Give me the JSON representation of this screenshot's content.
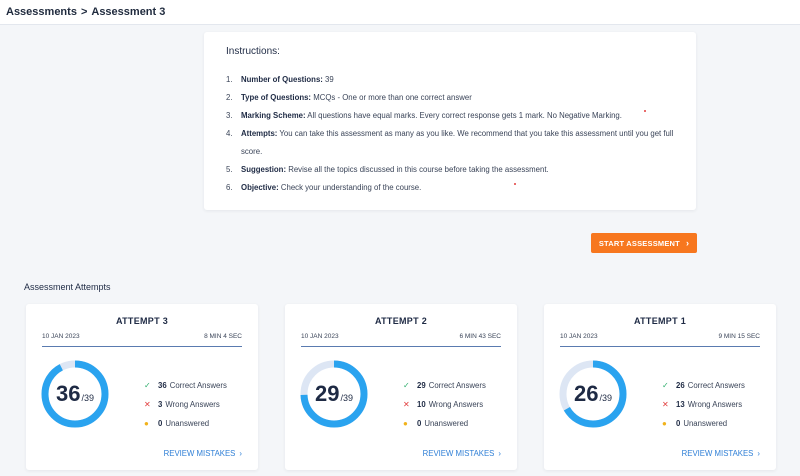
{
  "breadcrumb": {
    "root": "Assessments",
    "separator": ">",
    "current": "Assessment 3"
  },
  "instructions": {
    "title": "Instructions:",
    "items": [
      {
        "num": "1.",
        "label": "Number of Questions:",
        "text": " 39"
      },
      {
        "num": "2.",
        "label": "Type of Questions:",
        "text": " MCQs - One or more than one correct answer"
      },
      {
        "num": "3.",
        "label": "Marking Scheme:",
        "text": " All questions have equal marks. Every correct response gets 1 mark. No Negative Marking."
      },
      {
        "num": "4.",
        "label": "Attempts:",
        "text": " You can take this assessment as many as you like. We recommend that you take this assessment until you get full score."
      },
      {
        "num": "5.",
        "label": "Suggestion:",
        "text": " Revise all the topics discussed in this course before taking the assessment."
      },
      {
        "num": "6.",
        "label": "Objective:",
        "text": " Check your understanding of the course."
      }
    ]
  },
  "start_button": {
    "label": "START ASSESSMENT",
    "icon": "chevron-right-icon"
  },
  "attempts_title": "Assessment Attempts",
  "attempts": [
    {
      "title": "ATTEMPT 3",
      "date": "10 JAN 2023",
      "duration": "8 MIN 4 SEC",
      "score": "36",
      "total": "/39",
      "correct": "36",
      "wrong": "3",
      "unanswered": "0",
      "correct_label": "Correct Answers",
      "wrong_label": "Wrong Answers",
      "unanswered_label": "Unanswered",
      "review_label": "REVIEW MISTAKES",
      "fraction": 0.923
    },
    {
      "title": "ATTEMPT 2",
      "date": "10 JAN 2023",
      "duration": "6 MIN 43 SEC",
      "score": "29",
      "total": "/39",
      "correct": "29",
      "wrong": "10",
      "unanswered": "0",
      "correct_label": "Correct Answers",
      "wrong_label": "Wrong Answers",
      "unanswered_label": "Unanswered",
      "review_label": "REVIEW MISTAKES",
      "fraction": 0.744
    },
    {
      "title": "ATTEMPT 1",
      "date": "10 JAN 2023",
      "duration": "9 MIN 15 SEC",
      "score": "26",
      "total": "/39",
      "correct": "26",
      "wrong": "13",
      "unanswered": "0",
      "correct_label": "Correct Answers",
      "wrong_label": "Wrong Answers",
      "unanswered_label": "Unanswered",
      "review_label": "REVIEW MISTAKES",
      "fraction": 0.667
    }
  ],
  "colors": {
    "accent": "#f7771f",
    "ring": "#2aa3ef",
    "ring_track": "#dde6f4",
    "link": "#2f7fd6",
    "correct": "#2fae6d",
    "wrong": "#e23d3d",
    "unanswered": "#f1b21b"
  }
}
